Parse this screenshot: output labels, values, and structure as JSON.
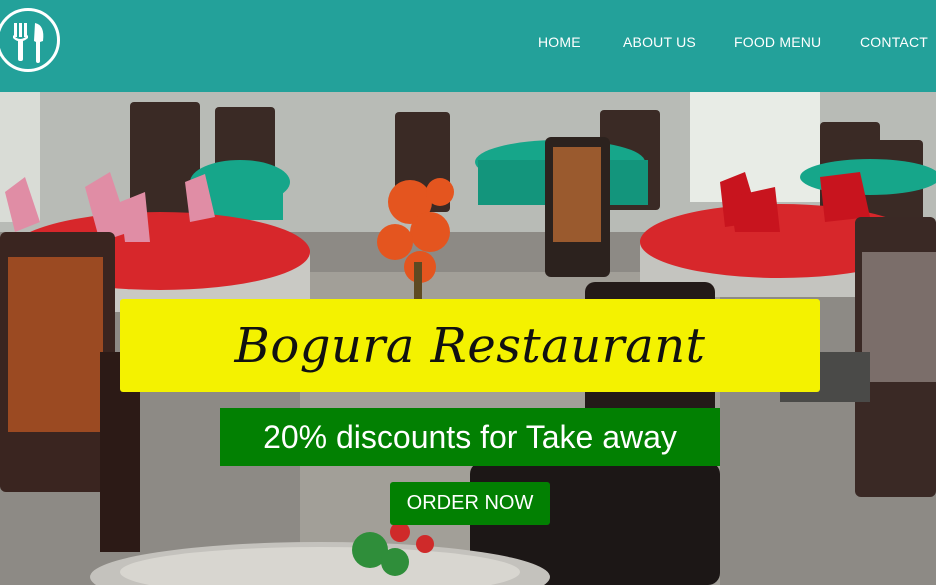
{
  "header": {
    "logo_icon": "fork-knife-icon",
    "nav": {
      "home": "HOME",
      "about": "ABOUT US",
      "food_menu": "FOOD MENU",
      "contact": "CONTACT"
    }
  },
  "hero": {
    "title": "Bogura Restaurant",
    "discount": "20% discounts for Take away",
    "order_button": "ORDER NOW"
  },
  "colors": {
    "header_bg": "#23a19a",
    "title_bg": "#f4f200",
    "green": "#028002",
    "tablecloth_red": "#d7272b",
    "tablecloth_teal": "#16a68a"
  }
}
